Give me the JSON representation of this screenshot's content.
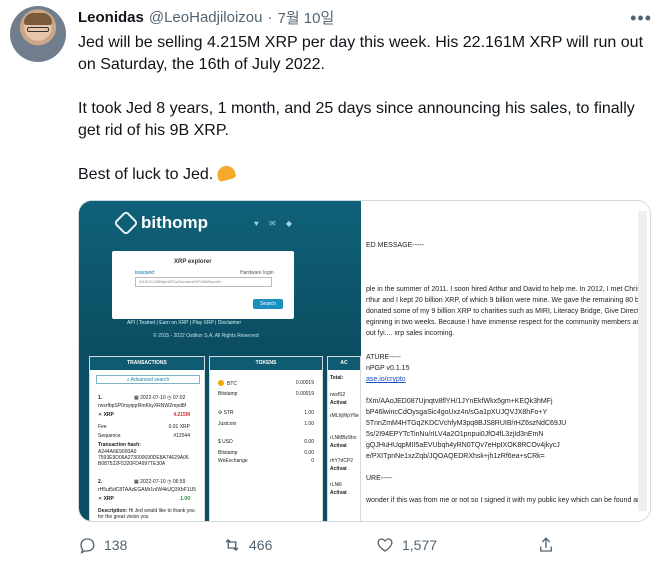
{
  "author": {
    "name": "Leonidas",
    "handle": "@LeoHadjiloizou",
    "separator": "·",
    "date": "7월 10일"
  },
  "tweet": {
    "paragraphs": [
      "Jed will be selling 4.215M XRP per day this week. His 22.161M XRP will run out on Saturday, the 16th of July 2022.",
      "It took Jed 8 years, 1 month, and 25 days since announcing his sales, to finally get rid of his 9B XRP.",
      "Best of luck to Jed."
    ],
    "emoji": "flexed-biceps-emoji"
  },
  "media": {
    "left": {
      "brand": "bithomp",
      "explorer_title": "XRP explorer",
      "toast": "toastand",
      "hardware_login": "Hardware login",
      "search_value": "rEHKZCz5fNdjmiROzZmnwkhHKFh5Wbyxs9x",
      "search_button": "Search",
      "footer_links": "API | Testnet | Earn on XRP | Play XRP | Disclaimer",
      "copyright": "© 2015 - 2022 Ostilion S.A. All Rights Reserved",
      "transactions": {
        "title": "TRANSACTIONS",
        "advanced_search": "Advanced search",
        "items": [
          {
            "index": "1.",
            "date": "2022-07-10",
            "time": "07:02",
            "from": "rwsrfbpSP0rsyqqrRmKkyXRNWZmpd8f",
            "asset": "XRP",
            "amount": "4.215M",
            "fee_label": "Fee",
            "fee_value": "0.01 XRP",
            "seq_label": "Sequence",
            "seq_value": "#12044",
            "hash_label": "Transaction hash:",
            "hash_value": "A244A6E9000A0 7593E9D06A273000690DE8A74629A06 B087522F5320FD4997TE30A"
          },
          {
            "index": "2.",
            "date": "2022-07-10",
            "time": "06:59",
            "from": "rH5ut5dC8TAAzEGAMr1nIW4kUQ3XbF1U5",
            "asset": "XRP",
            "amount": "1.00",
            "description_label": "Description:",
            "description_value": "Hi Jed would like to thank you for the great vision you"
          }
        ]
      },
      "tokens": {
        "title": "TOKENS",
        "items": [
          {
            "symbol": "BTC",
            "value": "0.00019",
            "issuer": "Bitstamp",
            "issuer_value": "0.00019"
          },
          {
            "symbol": "STR",
            "value": "1.00",
            "issuer": "Justcoin",
            "issuer_value": "1.00"
          },
          {
            "symbol": "USD",
            "value": "0.00",
            "issuer": "Bitstamp",
            "issuer_value": "0.00",
            "issuer2": "WeExchange",
            "issuer2_value": "0"
          }
        ]
      },
      "ac": {
        "title": "AC",
        "total": "Total:",
        "lines": [
          "rwsfS2",
          "Activat",
          "rMLhjWpY6e",
          "rLNMBz9ho",
          "Activat",
          "rhY7dCP2",
          "Activat",
          "rLNi6",
          "Activat"
        ]
      }
    },
    "right": {
      "lines": [
        "ED MESSAGE-----",
        "ple in the summer of 2011. I soon hired Arthur and David to help me. In 2012, I met Chris",
        "rthur and I kept 20 billion XRP, of which 9 billion were mine. We gave the remaining 80 bil",
        "donated some of my 9 billion XRP to charities such as MIRI, Literacy Bridge, Give Directly",
        "eginning in two weeks. Because I have immense respect for the community members and",
        "out fyi.... xrp sales incoming.",
        "ATURE-----",
        "nPGP v0.1.15",
        "ase.io/crypto",
        "fXm/AAoJED087Ujnqtv8flYH/1JYnEkfWkx5gm+KEQk3hMFj",
        "bP46lwincCdOysgaSic4goUxz4n/sGa1pXUJQVJX8hFo+Y",
        "5TnnZmM4HTGq2KDCVchfyM3pq8BJS8RUIB/rHZ6szNdC69JU",
        "5s/2I94EPYTcTinNu/rILV4a2O1pnpui0JfO4fL3zjId3nEmN",
        "gQJHuHUqpMII5aEVUbqh4yRN0TQv7eHpIXOK8RCOv4jkycJ",
        "e/PXITpnNe1xzZqb/JQOAQEDRXhsk+jh1zRf6ea+sCRk=",
        "URE-----",
        "wonder if this was from me or not so I signed it with my public key which can be found ar"
      ]
    }
  },
  "actions": {
    "reply_count": "138",
    "retweet_count": "466",
    "like_count": "1,577"
  }
}
